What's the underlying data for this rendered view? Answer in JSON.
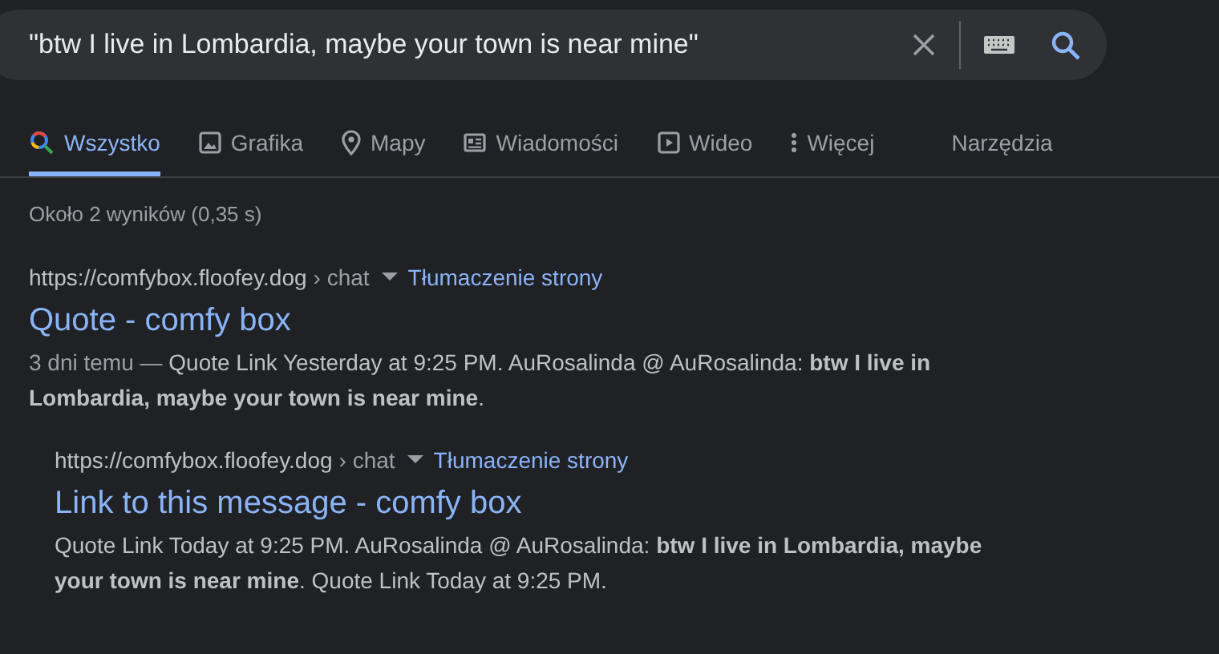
{
  "search": {
    "value": "\"btw I live in Lombardia, maybe your town is near mine\""
  },
  "tabs": [
    {
      "kind": "search",
      "label": "Wszystko",
      "selected": true
    },
    {
      "kind": "image",
      "label": "Grafika",
      "selected": false
    },
    {
      "kind": "pin",
      "label": "Mapy",
      "selected": false
    },
    {
      "kind": "news",
      "label": "Wiadomości",
      "selected": false
    },
    {
      "kind": "video",
      "label": "Wideo",
      "selected": false
    },
    {
      "kind": "more",
      "label": "Więcej",
      "selected": false
    }
  ],
  "tools": "Narzędzia",
  "result_stats": "Około 2 wyników (0,35 s)",
  "results": [
    {
      "url": "https://comfybox.floofey.dog",
      "crumb": "› chat",
      "translate": "Tłumaczenie strony",
      "title": "Quote - comfy box",
      "date": "3 dni temu —",
      "snippet": "Quote Link Yesterday at 9:25 PM. AuRosalinda @ AuRosalinda: **btw I live in Lombardia, maybe your town is near mine**.",
      "children": [
        {
          "url": "https://comfybox.floofey.dog",
          "crumb": "› chat",
          "translate": "Tłumaczenie strony",
          "title": "Link to this message - comfy box",
          "snippet": "Quote Link Today at 9:25 PM. AuRosalinda @ AuRosalinda: **btw I live in Lombardia, maybe your town is near mine**. Quote Link Today at 9:25 PM."
        }
      ]
    }
  ]
}
